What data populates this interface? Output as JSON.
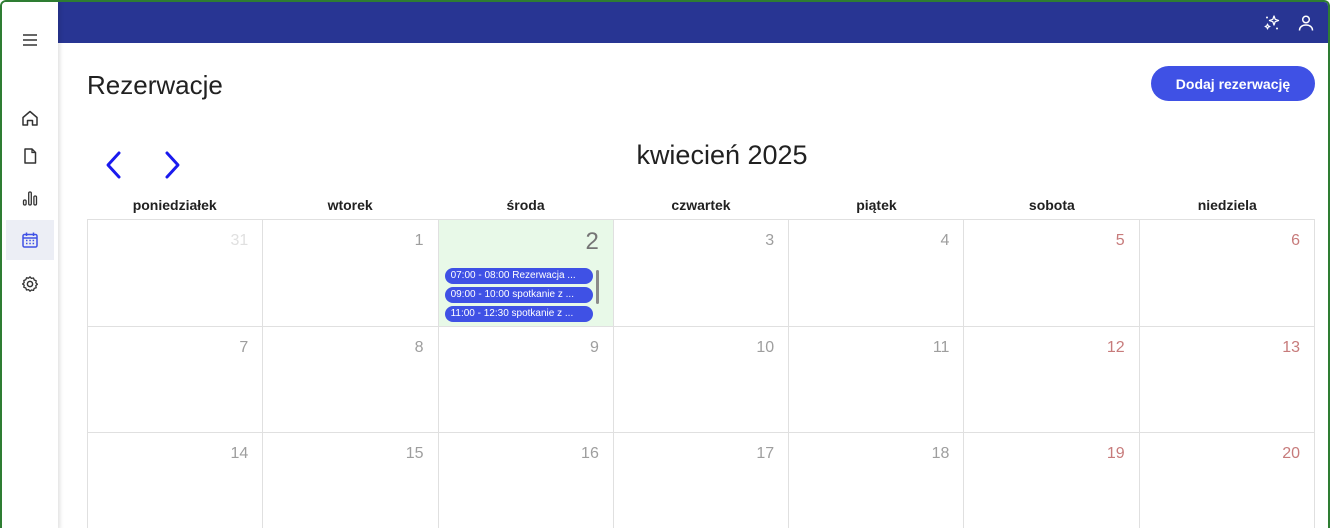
{
  "app": {
    "title": "Rezerwacje",
    "add_button_label": "Dodaj rezerwację",
    "accent_color": "#3f51e5",
    "topbar_color": "#283593"
  },
  "sidebar": {
    "items": [
      {
        "icon": "menu-icon"
      },
      {
        "icon": "home-icon"
      },
      {
        "icon": "document-icon"
      },
      {
        "icon": "bar-chart-icon"
      },
      {
        "icon": "calendar-icon",
        "active": true
      },
      {
        "icon": "gear-icon"
      }
    ]
  },
  "topbar": {
    "icons": [
      "sparkles-icon",
      "user-icon"
    ]
  },
  "calendar": {
    "month_label": "kwiecień 2025",
    "weekdays": [
      "poniedziałek",
      "wtorek",
      "środa",
      "czwartek",
      "piątek",
      "sobota",
      "niedziela"
    ],
    "weeks": [
      [
        {
          "day": "31",
          "other_month": true
        },
        {
          "day": "1"
        },
        {
          "day": "2",
          "today": true,
          "events": [
            "07:00 - 08:00 Rezerwacja ...",
            "09:00 - 10:00 spotkanie z ...",
            "11:00 - 12:30 spotkanie z ..."
          ]
        },
        {
          "day": "3"
        },
        {
          "day": "4"
        },
        {
          "day": "5",
          "weekend": true
        },
        {
          "day": "6",
          "weekend": true
        }
      ],
      [
        {
          "day": "7"
        },
        {
          "day": "8"
        },
        {
          "day": "9"
        },
        {
          "day": "10"
        },
        {
          "day": "11"
        },
        {
          "day": "12",
          "weekend": true
        },
        {
          "day": "13",
          "weekend": true
        }
      ],
      [
        {
          "day": "14"
        },
        {
          "day": "15"
        },
        {
          "day": "16"
        },
        {
          "day": "17"
        },
        {
          "day": "18"
        },
        {
          "day": "19",
          "weekend": true
        },
        {
          "day": "20",
          "weekend": true
        }
      ]
    ]
  }
}
